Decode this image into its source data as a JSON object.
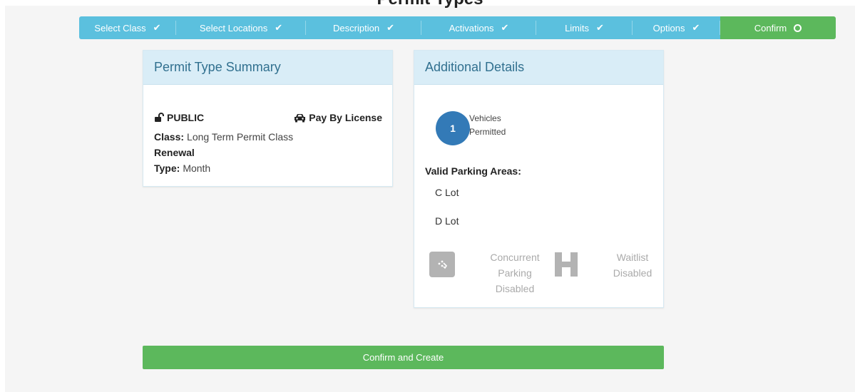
{
  "page": {
    "title": "Permit Types"
  },
  "wizard": {
    "steps": [
      {
        "label": "Select Class",
        "state": "done"
      },
      {
        "label": "Select Locations",
        "state": "done"
      },
      {
        "label": "Description",
        "state": "done"
      },
      {
        "label": "Activations",
        "state": "done"
      },
      {
        "label": "Limits",
        "state": "done"
      },
      {
        "label": "Options",
        "state": "done"
      },
      {
        "label": "Confirm",
        "state": "current"
      }
    ],
    "check_icon": "check-icon",
    "current_icon": "circle-icon",
    "colors": {
      "done": "#5bc0de",
      "current": "#5cb85c"
    }
  },
  "summary": {
    "title": "Permit Type Summary",
    "visibility": "PUBLIC",
    "visibility_icon": "unlock-icon",
    "payment": "Pay By License",
    "payment_icon": "car-icon",
    "class_label": "Class:",
    "class_value": "Long Term Permit Class",
    "renewal_label": "Renewal",
    "type_label": "Type:",
    "type_value": "Month"
  },
  "details": {
    "title": "Additional Details",
    "vehicles_count": "1",
    "vehicles_label_line1": "Vehicles",
    "vehicles_label_line2": "Permitted",
    "areas_title": "Valid Parking Areas:",
    "areas": [
      "C Lot",
      "D Lot"
    ],
    "concurrent": {
      "line1": "Concurrent",
      "line2": "Parking",
      "line3": "Disabled",
      "icon": "concurrent-parking-icon"
    },
    "waitlist": {
      "line1": "Waitlist",
      "line2": "Disabled",
      "icon": "waitlist-icon"
    }
  },
  "actions": {
    "confirm_label": "Confirm and Create"
  },
  "colors": {
    "accent_blue": "#337ab7",
    "panel_head": "#d9edf7",
    "success": "#5cb85c",
    "info": "#5bc0de"
  }
}
